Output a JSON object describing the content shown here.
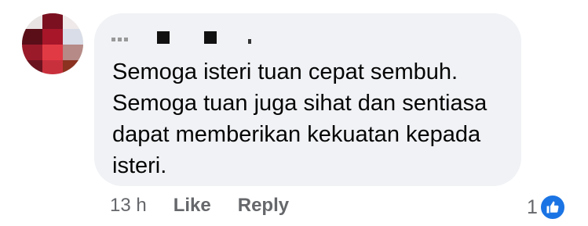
{
  "comment": {
    "author_name": "",
    "text": "Semoga isteri tuan cepat sembuh.\nSemoga tuan juga sihat dan sentiasa dapat memberikan kekuatan kepada isteri.",
    "timestamp": "13 h",
    "like_label": "Like",
    "reply_label": "Reply",
    "reaction_count": "1",
    "reaction_icon": "thumbs-up-icon",
    "colors": {
      "bubble": "#f0f2f5",
      "text": "#050505",
      "meta": "#65676b",
      "like_badge": "#1b74e4"
    }
  }
}
